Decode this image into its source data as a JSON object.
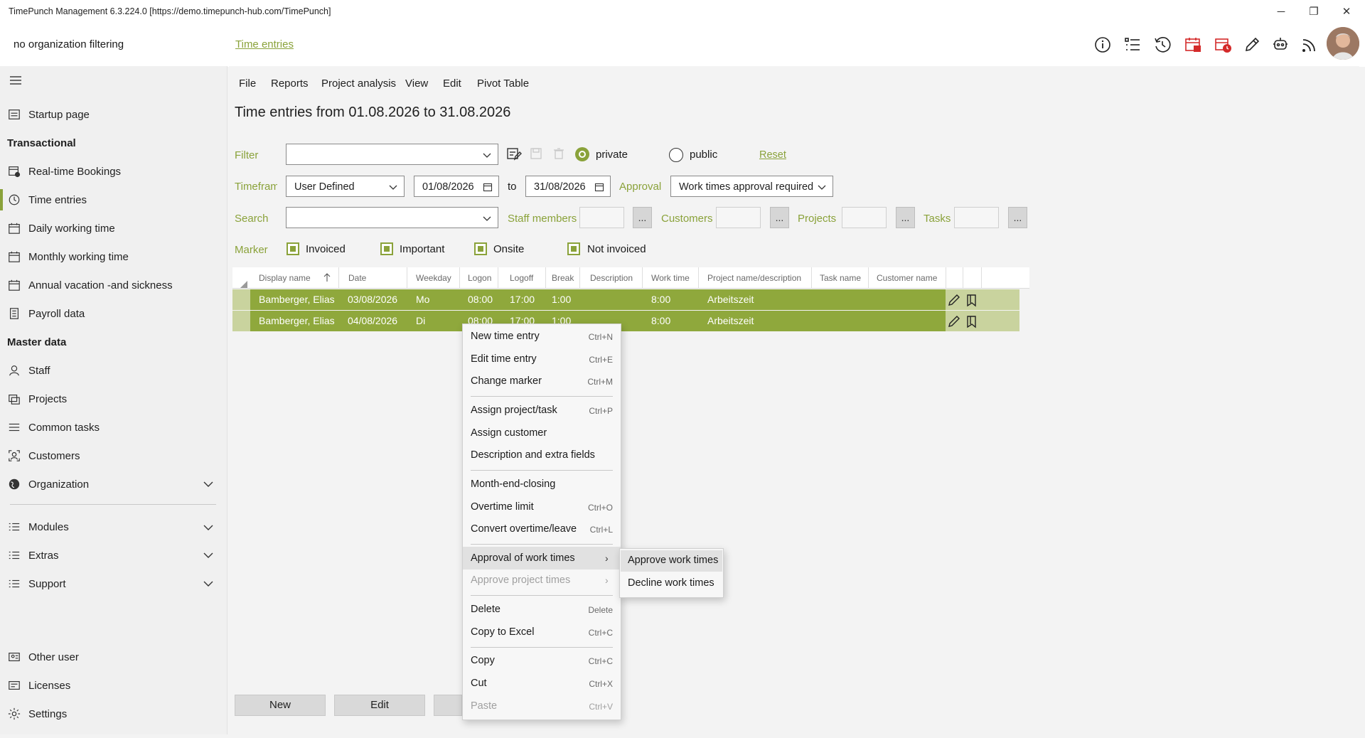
{
  "window": {
    "title": "TimePunch Management 6.3.224.0 [https://demo.timepunch-hub.com/TimePunch]",
    "minimize": "─",
    "restore": "❐",
    "close": "✕"
  },
  "header": {
    "org_filter": "no organization filtering",
    "breadcrumb_link": "Time entries",
    "icons": [
      "info-icon",
      "task-list-icon",
      "history-icon",
      "calendar-export-icon",
      "calendar-clock-icon",
      "pencil-icon",
      "robot-icon",
      "rss-feed-icon",
      "user-avatar"
    ]
  },
  "sidebar": {
    "menu_icon": "hamburger-icon",
    "startup": "Startup page",
    "transactional_heading": "Transactional",
    "transactional": [
      {
        "label": "Real-time Bookings",
        "icon": "realtime-icon"
      },
      {
        "label": "Time entries",
        "icon": "clock-icon"
      },
      {
        "label": "Daily working time",
        "icon": "calendar-day-icon"
      },
      {
        "label": "Monthly working time",
        "icon": "calendar-month-icon"
      },
      {
        "label": "Annual vacation -and sickness",
        "icon": "calendar-year-icon"
      },
      {
        "label": "Payroll data",
        "icon": "payroll-icon"
      }
    ],
    "master_heading": "Master data",
    "master": [
      {
        "label": "Staff",
        "icon": "person-icon"
      },
      {
        "label": "Projects",
        "icon": "projects-icon"
      },
      {
        "label": "Common tasks",
        "icon": "list-icon"
      },
      {
        "label": "Customers",
        "icon": "customer-icon"
      },
      {
        "label": "Organization",
        "icon": "globe-icon"
      }
    ],
    "groups": [
      {
        "label": "Modules",
        "icon": "list-icon"
      },
      {
        "label": "Extras",
        "icon": "list-icon"
      },
      {
        "label": "Support",
        "icon": "list-icon"
      }
    ],
    "bottom": [
      {
        "label": "Other user",
        "icon": "other-user-icon"
      },
      {
        "label": "Licenses",
        "icon": "license-icon"
      },
      {
        "label": "Settings",
        "icon": "gear-icon"
      }
    ]
  },
  "menubar": [
    "File",
    "Reports",
    "Project analysis",
    "View",
    "Edit",
    "Pivot Table"
  ],
  "page_title": "Time entries from 01.08.2026 to 31.08.2026",
  "filter": {
    "label": "Filter",
    "value": "",
    "private_label": "private",
    "public_label": "public",
    "private_selected": true,
    "reset": "Reset"
  },
  "timeframe": {
    "label": "Timeframe",
    "value": "User Defined",
    "from": "01/08/2026",
    "to_label": "to",
    "to": "31/08/2026",
    "approval_label": "Approval",
    "approval_value": "Work times approval required"
  },
  "search": {
    "label": "Search",
    "value": "",
    "staff_label": "Staff members",
    "customers_label": "Customers",
    "projects_label": "Projects",
    "tasks_label": "Tasks",
    "dots": "..."
  },
  "marker": {
    "label": "Marker",
    "items": [
      "Invoiced",
      "Important",
      "Onsite",
      "Not invoiced"
    ]
  },
  "grid": {
    "columns": [
      "Display name",
      "Date",
      "Weekday",
      "Logon",
      "Logoff",
      "Break",
      "Description",
      "Work time",
      "Project name/description",
      "Task name",
      "Customer name"
    ],
    "rows": [
      {
        "name": "Bamberger, Elias",
        "date": "03/08/2026",
        "weekday": "Mo",
        "logon": "08:00",
        "logoff": "17:00",
        "break": "1:00",
        "description": "",
        "work_time": "8:00",
        "project": "Arbeitszeit",
        "task": "",
        "customer": ""
      },
      {
        "name": "Bamberger, Elias",
        "date": "04/08/2026",
        "weekday": "Di",
        "logon": "08:00",
        "logoff": "17:00",
        "break": "1:00",
        "description": "",
        "work_time": "8:00",
        "project": "Arbeitszeit",
        "task": "",
        "customer": ""
      }
    ]
  },
  "buttons": {
    "new": "New",
    "edit": "Edit"
  },
  "context_menu": {
    "items": [
      {
        "label": "New time entry",
        "shortcut": "Ctrl+N"
      },
      {
        "label": "Edit time entry",
        "shortcut": "Ctrl+E"
      },
      {
        "label": "Change marker",
        "shortcut": "Ctrl+M"
      },
      {
        "label": "Assign project/task",
        "shortcut": "Ctrl+P"
      },
      {
        "label": "Assign customer",
        "shortcut": ""
      },
      {
        "label": "Description and extra fields",
        "shortcut": ""
      },
      {
        "label": "Month-end-closing",
        "shortcut": ""
      },
      {
        "label": "Overtime limit",
        "shortcut": "Ctrl+O"
      },
      {
        "label": "Convert overtime/leave",
        "shortcut": "Ctrl+L"
      },
      {
        "label": "Approval of work times",
        "shortcut": ""
      },
      {
        "label": "Approve project times",
        "shortcut": ""
      },
      {
        "label": "Delete",
        "shortcut": "Delete"
      },
      {
        "label": "Copy to Excel",
        "shortcut": "Ctrl+C"
      },
      {
        "label": "Copy",
        "shortcut": "Ctrl+C"
      },
      {
        "label": "Cut",
        "shortcut": "Ctrl+X"
      },
      {
        "label": "Paste",
        "shortcut": "Ctrl+V"
      }
    ],
    "submenu": [
      "Approve work times",
      "Decline work times"
    ]
  },
  "colors": {
    "accent": "#8aa23a",
    "row_bg": "#8fa83c",
    "window_bg": "#f3f3f3"
  }
}
